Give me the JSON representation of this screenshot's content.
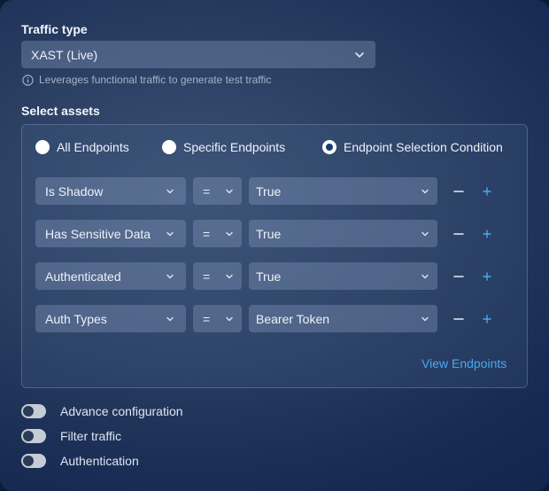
{
  "traffic_type": {
    "label": "Traffic type",
    "value": "XAST (Live)",
    "hint": "Leverages functional traffic to generate test traffic"
  },
  "assets": {
    "label": "Select assets",
    "radios": [
      {
        "label": "All Endpoints",
        "selected": false
      },
      {
        "label": "Specific Endpoints",
        "selected": false
      },
      {
        "label": "Endpoint Selection Condition",
        "selected": true
      }
    ],
    "conditions": [
      {
        "field": "Is Shadow",
        "op": "=",
        "value": "True"
      },
      {
        "field": "Has Sensitive Data",
        "op": "=",
        "value": "True"
      },
      {
        "field": "Authenticated",
        "op": "=",
        "value": "True"
      },
      {
        "field": "Auth Types",
        "op": "=",
        "value": "Bearer Token"
      }
    ],
    "view_link": "View Endpoints"
  },
  "toggles": [
    {
      "label": "Advance configuration",
      "on": false
    },
    {
      "label": "Filter traffic",
      "on": false
    },
    {
      "label": "Authentication",
      "on": false
    }
  ],
  "colors": {
    "accent": "#4aa8ee"
  }
}
